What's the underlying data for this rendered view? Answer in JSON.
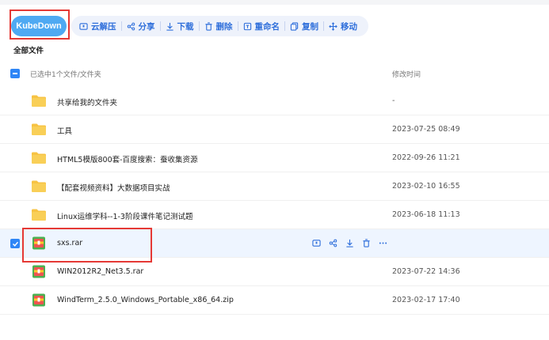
{
  "toolbar": {
    "primary_label": "KubeDown",
    "buttons": [
      {
        "label": "云解压",
        "icon": "cloud-unzip-icon"
      },
      {
        "label": "分享",
        "icon": "share-icon"
      },
      {
        "label": "下载",
        "icon": "download-icon"
      },
      {
        "label": "删除",
        "icon": "trash-icon"
      },
      {
        "label": "重命名",
        "icon": "rename-icon"
      },
      {
        "label": "复制",
        "icon": "copy-icon"
      },
      {
        "label": "移动",
        "icon": "move-icon"
      }
    ]
  },
  "breadcrumb": "全部文件",
  "list_header": {
    "selection_text": "已选中1个文件/文件夹",
    "time_col": "修改时间"
  },
  "files": [
    {
      "name": "共享给我的文件夹",
      "time": "-",
      "type": "folder"
    },
    {
      "name": "工具",
      "time": "2023-07-25 08:49",
      "type": "folder"
    },
    {
      "name": "HTML5模版800套-百度搜索：蚕收集资源",
      "time": "2022-09-26 11:21",
      "type": "folder"
    },
    {
      "name": "【配套视频资料】大数据项目实战",
      "time": "2023-02-10 16:55",
      "type": "folder"
    },
    {
      "name": "Linux运维学科--1-3阶段课件笔记测试题",
      "time": "2023-06-18 11:13",
      "type": "folder"
    },
    {
      "name": "sxs.rar",
      "time": "",
      "type": "archive",
      "selected": true
    },
    {
      "name": "WIN2012R2_Net3.5.rar",
      "time": "2023-07-22 14:36",
      "type": "archive"
    },
    {
      "name": "WindTerm_2.5.0_Windows_Portable_x86_64.zip",
      "time": "2023-02-17 17:40",
      "type": "archive"
    }
  ],
  "colors": {
    "accent": "#2f86f6",
    "primary_button": "#4fa9f2",
    "highlight": "#e53935",
    "folder": "#f7c343"
  }
}
